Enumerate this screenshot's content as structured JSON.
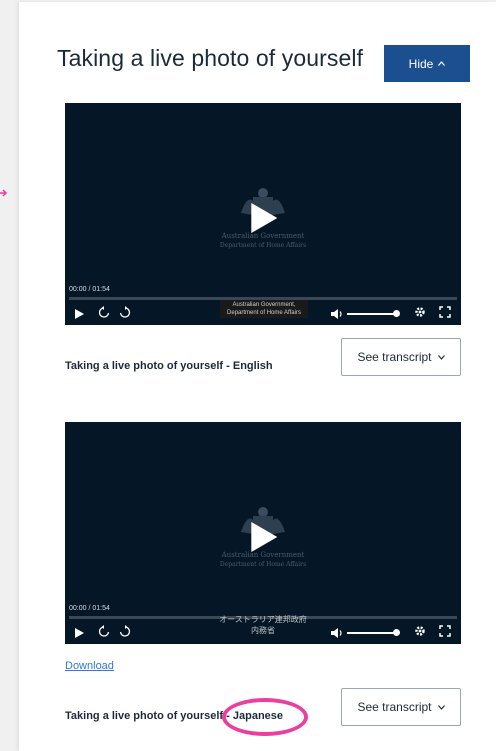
{
  "header": {
    "title": "Taking a live photo of yourself",
    "hide_label": "Hide"
  },
  "videos": [
    {
      "label": "Taking a live photo of yourself - English",
      "time": "00:00 / 01:54",
      "crest_line1": "Australian Government",
      "crest_line2": "Department of Home Affairs",
      "caption_line1": "Australian Government,",
      "caption_line2": "Department of Home Affairs",
      "transcript_label": "See transcript"
    },
    {
      "label": "Taking a live photo of yourself - Japanese",
      "time": "00:00 / 01:54",
      "crest_line1": "Australian Government",
      "crest_line2": "Department of Home Affairs",
      "caption_line1": "オーストラリア連邦政府",
      "caption_line2": "内務省",
      "transcript_label": "See transcript",
      "download_label": "Download"
    }
  ],
  "colors": {
    "primary_button": "#1c4f8f",
    "video_bg": "#051626",
    "link": "#2f7bc9",
    "annotation": "#ea3ea0"
  }
}
